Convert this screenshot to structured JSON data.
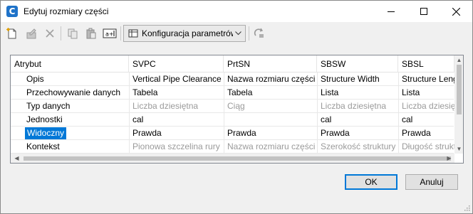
{
  "window": {
    "title": "Edytuj rozmiary części",
    "app_icon_letter": "C"
  },
  "toolbar": {
    "config_label": "Konfiguracja parametrów",
    "icons": [
      "new-icon",
      "edit-icon",
      "delete-icon",
      "copy-icon",
      "paste-icon",
      "rename-icon",
      "settings-icon",
      "refresh-icon"
    ]
  },
  "grid": {
    "columns": [
      "Atrybut",
      "SVPC",
      "PrtSN",
      "SBSW",
      "SBSL"
    ],
    "rows": [
      {
        "attr": "Opis",
        "cells": [
          "Vertical Pipe Clearance",
          "Nazwa rozmiaru części",
          "Structure Width",
          "Structure Length"
        ],
        "gray": [
          false,
          false,
          false,
          false
        ]
      },
      {
        "attr": "Przechowywanie danych",
        "cells": [
          "Tabela",
          "Tabela",
          "Lista",
          "Lista"
        ],
        "gray": [
          false,
          false,
          false,
          false
        ]
      },
      {
        "attr": "Typ danych",
        "cells": [
          "Liczba dziesiętna",
          "Ciąg",
          "Liczba dziesiętna",
          "Liczba dziesiętna"
        ],
        "gray": [
          true,
          true,
          true,
          true
        ]
      },
      {
        "attr": "Jednostki",
        "cells": [
          "cal",
          "",
          "cal",
          "cal"
        ],
        "gray": [
          false,
          false,
          false,
          false
        ]
      },
      {
        "attr": "Widoczny",
        "cells": [
          "Prawda",
          "Prawda",
          "Prawda",
          "Prawda"
        ],
        "gray": [
          false,
          false,
          false,
          false
        ],
        "selected": true
      },
      {
        "attr": "Kontekst",
        "cells": [
          "Pionowa szczelina rury",
          "Nazwa rozmiaru części",
          "Szerokość struktury",
          "Długość struktury"
        ],
        "gray": [
          true,
          true,
          true,
          true
        ]
      }
    ]
  },
  "buttons": {
    "ok": "OK",
    "cancel": "Anuluj"
  },
  "colors": {
    "selection": "#0078d7",
    "app_icon": "#1f73c9"
  }
}
